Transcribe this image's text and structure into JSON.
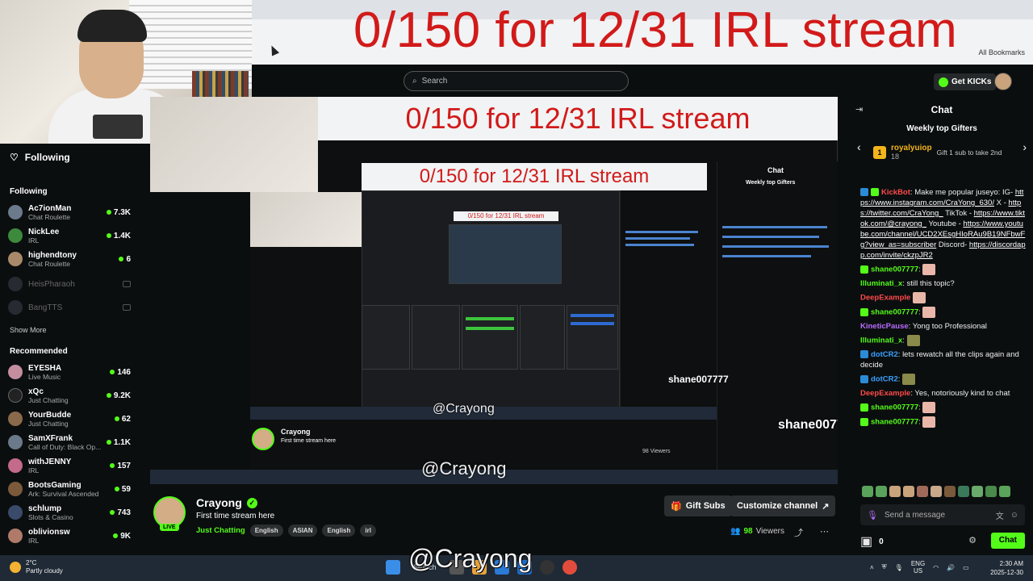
{
  "overlay": {
    "title": "0/150 for 12/31 IRL stream"
  },
  "browser": {
    "bookmarks": "All Bookmarks"
  },
  "header": {
    "search_placeholder": "Search",
    "get_kicks": "Get KICKs"
  },
  "sidebar": {
    "following_title": "Following",
    "following_section": "Following",
    "following": [
      {
        "name": "Ac7ionMan",
        "category": "Chat Roulette",
        "viewers": "7.3K",
        "live": true
      },
      {
        "name": "NickLee",
        "category": "IRL",
        "viewers": "1.4K",
        "live": true
      },
      {
        "name": "highendtony",
        "category": "Chat Roulette",
        "viewers": "6",
        "live": true
      },
      {
        "name": "HeisPharaoh",
        "category": "",
        "viewers": "",
        "live": false
      },
      {
        "name": "BangTTS",
        "category": "",
        "viewers": "",
        "live": false
      }
    ],
    "show_more": "Show More",
    "recommended_section": "Recommended",
    "recommended": [
      {
        "name": "EYESHA",
        "category": "Live Music",
        "viewers": "146"
      },
      {
        "name": "xQc",
        "category": "Just Chatting",
        "viewers": "9.2K"
      },
      {
        "name": "YourBudde",
        "category": "Just Chatting",
        "viewers": "62"
      },
      {
        "name": "SamXFrank",
        "category": "Call of Duty: Black Op...",
        "viewers": "1.1K"
      },
      {
        "name": "withJENNY",
        "category": "IRL",
        "viewers": "157"
      },
      {
        "name": "BootsGaming",
        "category": "Ark: Survival Ascended",
        "viewers": "59"
      },
      {
        "name": "schlump",
        "category": "Slots & Casino",
        "viewers": "743"
      },
      {
        "name": "oblivionsw",
        "category": "IRL",
        "viewers": "9K"
      }
    ]
  },
  "video": {
    "inner_title": "0/150 for 12/31 IRL stream",
    "inner_chat": "Chat",
    "inner_gifters": "Weekly top Gifters",
    "inner_channel": "Crayong",
    "inner_stream_title": "First time stream here",
    "inner_viewers": "98 Viewers",
    "inner_shane": "shane007777",
    "inner_watermark": "@Crayong"
  },
  "channel": {
    "name": "Crayong",
    "live_badge": "LIVE",
    "stream_title": "First time stream here",
    "category": "Just Chatting",
    "tags": [
      "English",
      "ASIAN",
      "English",
      "irl"
    ],
    "gift_subs": "Gift Subs",
    "customize": "Customize channel",
    "viewer_count": "98",
    "viewer_label": "Viewers"
  },
  "chat": {
    "title": "Chat",
    "weekly_gifters": "Weekly top Gifters",
    "gifter_rank": "1",
    "gifter_name": "royalyuiop",
    "gifter_count": "18",
    "gifter_sub": "Gift 1 sub to take 2nd",
    "messages": [
      {
        "user": "KickBot",
        "user_color": "#ff4a4a",
        "text_before": "Make me popular juseyo: IG-",
        "links": [
          "https://www.instagram.com/CraYong_630/",
          "https://twitter.com/CraYong_",
          "https://www.tiktok.com/@crayong_",
          "https://www.youtube.com/channel/UCD2XEsgHIoRAu9B19NFbwFg?view_as=subscriber",
          "https://discordapp.com/invite/ckzpJR2"
        ],
        "link_sep": [
          " X -",
          " TikTok -",
          " Youtube -",
          " Discord-"
        ]
      },
      {
        "user": "shane007777",
        "user_color": "#53fc18",
        "text": ""
      },
      {
        "user": "Illuminati_x",
        "user_color": "#53fc18",
        "text": "still this topic?"
      },
      {
        "user": "DeepExample",
        "user_color": "#ff4a4a",
        "text": ""
      },
      {
        "user": "shane007777",
        "user_color": "#53fc18",
        "text": ""
      },
      {
        "user": "KineticPause",
        "user_color": "#b86cff",
        "text": "Yong too Professional"
      },
      {
        "user": "Illuminati_x",
        "user_color": "#53fc18",
        "text": ""
      },
      {
        "user": "dotCR2",
        "user_color": "#3aa0ff",
        "text": "lets rewatch all the clips again and decide"
      },
      {
        "user": "dotCR2",
        "user_color": "#3aa0ff",
        "text": ""
      },
      {
        "user": "DeepExample",
        "user_color": "#ff4a4a",
        "text": "Yes, notoriously kind to chat"
      },
      {
        "user": "shane007777",
        "user_color": "#53fc18",
        "text": ""
      },
      {
        "user": "shane007777",
        "user_color": "#53fc18",
        "text": ""
      },
      {
        "user": "shane007777",
        "user_color": "#53fc18",
        "text": ""
      },
      {
        "user": "shane007777",
        "user_color": "#53fc18",
        "text": ""
      }
    ],
    "input_placeholder": "Send a message",
    "points": "0",
    "send": "Chat"
  },
  "taskbar": {
    "temp": "2°C",
    "weather": "Partly cloudy",
    "search": "Search",
    "watermark": "@Crayong",
    "lang1": "ENG",
    "lang2": "US",
    "time": "2:30 AM",
    "date": "2025-12-30"
  },
  "colors": {
    "accent": "#53fc18",
    "overlay_red": "#d21a1a",
    "background": "#0b0e0f"
  }
}
